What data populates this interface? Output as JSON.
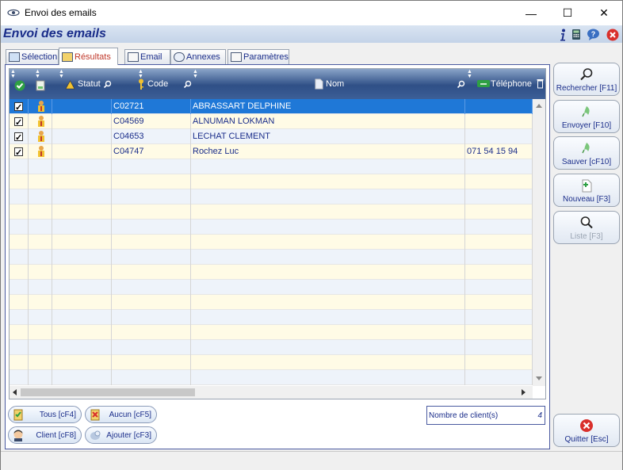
{
  "window": {
    "title": "Envoi des emails",
    "minimize": "—",
    "maximize": "☐",
    "close": "✕"
  },
  "header": {
    "title": "Envoi des emails"
  },
  "tabs": [
    {
      "label": "Sélection",
      "active": false
    },
    {
      "label": "Résultats",
      "active": true
    },
    {
      "label": "Email",
      "active": false
    },
    {
      "label": "Annexes",
      "active": false
    },
    {
      "label": "Paramètres",
      "active": false
    }
  ],
  "grid": {
    "columns": {
      "statut": "Statut",
      "code": "Code",
      "nom": "Nom",
      "telephone": "Téléphone"
    },
    "rows": [
      {
        "checked": true,
        "code": "C02721",
        "nom": "ABRASSART DELPHINE",
        "telephone": "",
        "selected": true
      },
      {
        "checked": true,
        "code": "C04569",
        "nom": "ALNUMAN LOKMAN",
        "telephone": ""
      },
      {
        "checked": true,
        "code": "C04653",
        "nom": "LECHAT CLEMENT",
        "telephone": ""
      },
      {
        "checked": true,
        "code": "C04747",
        "nom": "Rochez Luc",
        "telephone": "071 54 15 94"
      }
    ]
  },
  "bottom_buttons": {
    "tous": "Tous [cF4]",
    "aucun": "Aucun [cF5]",
    "client": "Client [cF8]",
    "ajouter": "Ajouter [cF3]"
  },
  "count": {
    "label": "Nombre de client(s)",
    "value": "4"
  },
  "side_buttons": {
    "rechercher": "Rechercher [F11]",
    "envoyer": "Envoyer [F10]",
    "sauver": "Sauver [cF10]",
    "nouveau": "Nouveau [F3]",
    "liste": "Liste [F3]",
    "quitter": "Quitter [Esc]"
  },
  "colors": {
    "accent": "#1a2d8a",
    "selection": "#1f78d7",
    "header_dark": "#2f4f86",
    "active_tab_text": "#c0392b"
  }
}
